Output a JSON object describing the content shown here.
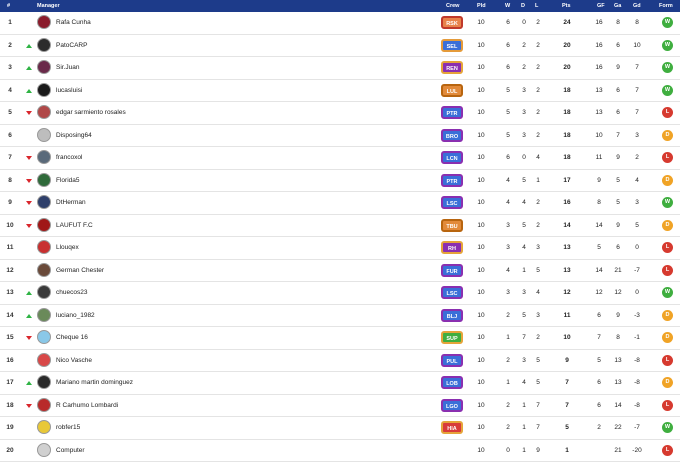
{
  "header": {
    "pos": "#",
    "manager": "Manager",
    "crew": "Crew",
    "pld": "Pld",
    "w": "W",
    "d": "D",
    "l": "L",
    "pts": "Pts",
    "gf": "GF",
    "ga": "Ga",
    "gd": "Gd",
    "form": "Form"
  },
  "colors": {
    "header_bg": "#1d3b8a",
    "win": "#3fae3f",
    "draw": "#f0a326",
    "loss": "#d63a2f",
    "up_arrow": "#2fb344",
    "down_arrow": "#d9262c"
  },
  "rows": [
    {
      "pos": "1",
      "trend": "none",
      "name": "Rafa Cunha",
      "avatar": "#8b1c2c",
      "crew": "RSK",
      "crew_fill": "#e8824a",
      "crew_border": "#c0392b",
      "pld": "10",
      "w": "6",
      "d": "0",
      "l": "2",
      "pts": "24",
      "gf": "16",
      "ga": "8",
      "gd": "8",
      "form": "W"
    },
    {
      "pos": "2",
      "trend": "up",
      "name": "PatoCARP",
      "avatar": "#2c2c2c",
      "crew": "SEL",
      "crew_fill": "#3a6fd8",
      "crew_border": "#e59b3a",
      "pld": "10",
      "w": "6",
      "d": "2",
      "l": "2",
      "pts": "20",
      "gf": "16",
      "ga": "6",
      "gd": "10",
      "form": "W"
    },
    {
      "pos": "3",
      "trend": "up",
      "name": "Sir.Juan",
      "avatar": "#6a2a4a",
      "crew": "REN",
      "crew_fill": "#8a2fb0",
      "crew_border": "#e5a43a",
      "pld": "10",
      "w": "6",
      "d": "2",
      "l": "2",
      "pts": "20",
      "gf": "16",
      "ga": "9",
      "gd": "7",
      "form": "W"
    },
    {
      "pos": "4",
      "trend": "up",
      "name": "lucasluisi",
      "avatar": "#1a1a1a",
      "crew": "LUL",
      "crew_fill": "#e28a3a",
      "crew_border": "#b8650f",
      "pld": "10",
      "w": "5",
      "d": "3",
      "l": "2",
      "pts": "18",
      "gf": "13",
      "ga": "6",
      "gd": "7",
      "form": "W"
    },
    {
      "pos": "5",
      "trend": "down",
      "name": "edgar sarmiento rosales",
      "avatar": "#b04848",
      "crew": "PTR",
      "crew_fill": "#3a6fd8",
      "crew_border": "#8a2fb0",
      "pld": "10",
      "w": "5",
      "d": "3",
      "l": "2",
      "pts": "18",
      "gf": "13",
      "ga": "6",
      "gd": "7",
      "form": "L"
    },
    {
      "pos": "6",
      "trend": "none",
      "name": "Disposing64",
      "avatar": "#bdbdbd",
      "crew": "BRO",
      "crew_fill": "#3a6fd8",
      "crew_border": "#8a2fb0",
      "pld": "10",
      "w": "5",
      "d": "3",
      "l": "2",
      "pts": "18",
      "gf": "10",
      "ga": "7",
      "gd": "3",
      "form": "D"
    },
    {
      "pos": "7",
      "trend": "down",
      "name": "francoxol",
      "avatar": "#5a6a7a",
      "crew": "LCN",
      "crew_fill": "#3a6fd8",
      "crew_border": "#8a2fb0",
      "pld": "10",
      "w": "6",
      "d": "0",
      "l": "4",
      "pts": "18",
      "gf": "11",
      "ga": "9",
      "gd": "2",
      "form": "L"
    },
    {
      "pos": "8",
      "trend": "down",
      "name": "Florida5",
      "avatar": "#2f6a3a",
      "crew": "PTR",
      "crew_fill": "#3a6fd8",
      "crew_border": "#8a2fb0",
      "pld": "10",
      "w": "4",
      "d": "5",
      "l": "1",
      "pts": "17",
      "gf": "9",
      "ga": "5",
      "gd": "4",
      "form": "D"
    },
    {
      "pos": "9",
      "trend": "down",
      "name": "DtHerman",
      "avatar": "#2f3f6a",
      "crew": "LSC",
      "crew_fill": "#3a6fd8",
      "crew_border": "#8a2fb0",
      "pld": "10",
      "w": "4",
      "d": "4",
      "l": "2",
      "pts": "16",
      "gf": "8",
      "ga": "5",
      "gd": "3",
      "form": "W"
    },
    {
      "pos": "10",
      "trend": "down",
      "name": "LAUFUT F.C",
      "avatar": "#a01818",
      "crew": "TBU",
      "crew_fill": "#e28a3a",
      "crew_border": "#b8650f",
      "pld": "10",
      "w": "3",
      "d": "5",
      "l": "2",
      "pts": "14",
      "gf": "14",
      "ga": "9",
      "gd": "5",
      "form": "D"
    },
    {
      "pos": "11",
      "trend": "none",
      "name": "Llouqex",
      "avatar": "#c83030",
      "crew": "RH",
      "crew_fill": "#8a2fb0",
      "crew_border": "#e5a43a",
      "pld": "10",
      "w": "3",
      "d": "4",
      "l": "3",
      "pts": "13",
      "gf": "5",
      "ga": "6",
      "gd": "0",
      "form": "L"
    },
    {
      "pos": "12",
      "trend": "none",
      "name": "German Chester",
      "avatar": "#6a4a3a",
      "crew": "FUR",
      "crew_fill": "#3a6fd8",
      "crew_border": "#8a2fb0",
      "pld": "10",
      "w": "4",
      "d": "1",
      "l": "5",
      "pts": "13",
      "gf": "14",
      "ga": "21",
      "gd": "-7",
      "form": "L"
    },
    {
      "pos": "13",
      "trend": "up",
      "name": "chuecos23",
      "avatar": "#3a3a3a",
      "crew": "LSC",
      "crew_fill": "#3a6fd8",
      "crew_border": "#8a2fb0",
      "pld": "10",
      "w": "3",
      "d": "3",
      "l": "4",
      "pts": "12",
      "gf": "12",
      "ga": "12",
      "gd": "0",
      "form": "W"
    },
    {
      "pos": "14",
      "trend": "up",
      "name": "luciano_1982",
      "avatar": "#6a8a5a",
      "crew": "BLJ",
      "crew_fill": "#3a6fd8",
      "crew_border": "#8a2fb0",
      "pld": "10",
      "w": "2",
      "d": "5",
      "l": "3",
      "pts": "11",
      "gf": "6",
      "ga": "9",
      "gd": "-3",
      "form": "D"
    },
    {
      "pos": "15",
      "trend": "down",
      "name": "Cheque 16",
      "avatar": "#8ac8e8",
      "crew": "SUP",
      "crew_fill": "#3fae3f",
      "crew_border": "#e5a43a",
      "pld": "10",
      "w": "1",
      "d": "7",
      "l": "2",
      "pts": "10",
      "gf": "7",
      "ga": "8",
      "gd": "-1",
      "form": "D"
    },
    {
      "pos": "16",
      "trend": "none",
      "name": "Nico Vasche",
      "avatar": "#d84848",
      "crew": "PUL",
      "crew_fill": "#3a6fd8",
      "crew_border": "#8a2fb0",
      "pld": "10",
      "w": "2",
      "d": "3",
      "l": "5",
      "pts": "9",
      "gf": "5",
      "ga": "13",
      "gd": "-8",
      "form": "L"
    },
    {
      "pos": "17",
      "trend": "up",
      "name": "Mariano martin dominguez",
      "avatar": "#2a2a2a",
      "crew": "LOB",
      "crew_fill": "#3a6fd8",
      "crew_border": "#8a2fb0",
      "pld": "10",
      "w": "1",
      "d": "4",
      "l": "5",
      "pts": "7",
      "gf": "6",
      "ga": "13",
      "gd": "-8",
      "form": "D"
    },
    {
      "pos": "18",
      "trend": "down",
      "name": "R Carhumo Lombardi",
      "avatar": "#b82a2a",
      "crew": "LGO",
      "crew_fill": "#3a6fd8",
      "crew_border": "#8a2fb0",
      "pld": "10",
      "w": "2",
      "d": "1",
      "l": "7",
      "pts": "7",
      "gf": "6",
      "ga": "14",
      "gd": "-8",
      "form": "L"
    },
    {
      "pos": "19",
      "trend": "none",
      "name": "robfer15",
      "avatar": "#e8c838",
      "crew": "HIA",
      "crew_fill": "#d83a3a",
      "crew_border": "#e5a43a",
      "pld": "10",
      "w": "2",
      "d": "1",
      "l": "7",
      "pts": "5",
      "gf": "2",
      "ga": "22",
      "gd": "-7",
      "form": "W"
    },
    {
      "pos": "20",
      "trend": "none",
      "name": "Computer",
      "avatar": "#d0d0d0",
      "crew": "",
      "crew_fill": "",
      "crew_border": "",
      "pld": "10",
      "w": "0",
      "d": "1",
      "l": "9",
      "pts": "1",
      "gf": "",
      "ga": "21",
      "gd": "-20",
      "form": "L"
    }
  ]
}
